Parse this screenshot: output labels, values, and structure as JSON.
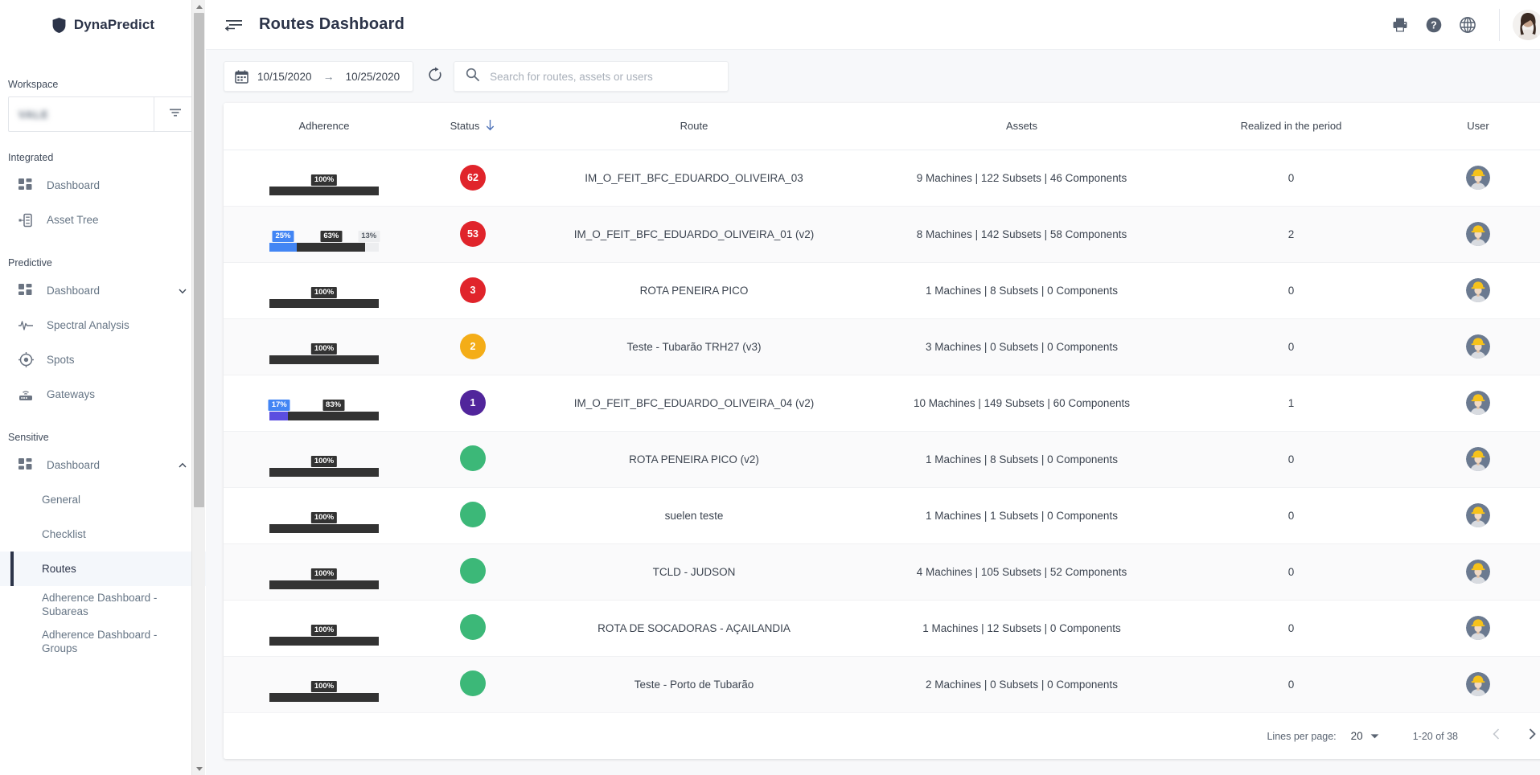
{
  "brand": {
    "name": "DynaPredict",
    "icon": "shield-icon"
  },
  "sidebar": {
    "workspace_label": "Workspace",
    "workspace_value": "VALE",
    "filter_icon": "filter-icon",
    "groups": [
      {
        "label": "Integrated",
        "items": [
          {
            "label": "Dashboard",
            "icon": "dashboard-icon",
            "chevron": null
          },
          {
            "label": "Asset Tree",
            "icon": "asset-tree-icon",
            "chevron": null
          }
        ]
      },
      {
        "label": "Predictive",
        "items": [
          {
            "label": "Dashboard",
            "icon": "dashboard-icon",
            "chevron": "chevron-down-icon"
          },
          {
            "label": "Spectral Analysis",
            "icon": "spectral-analysis-icon",
            "chevron": null
          },
          {
            "label": "Spots",
            "icon": "spots-icon",
            "chevron": null
          },
          {
            "label": "Gateways",
            "icon": "gateways-icon",
            "chevron": null
          }
        ]
      },
      {
        "label": "Sensitive",
        "items": [
          {
            "label": "Dashboard",
            "icon": "dashboard-icon",
            "chevron": "chevron-up-icon"
          }
        ],
        "subitems": [
          {
            "label": "General",
            "active": false
          },
          {
            "label": "Checklist",
            "active": false
          },
          {
            "label": "Routes",
            "active": true
          },
          {
            "label": "Adherence Dashboard - Subareas",
            "active": false
          },
          {
            "label": "Adherence Dashboard - Groups",
            "active": false
          }
        ]
      }
    ]
  },
  "topbar": {
    "menu_icon": "hamburger-collapse-icon",
    "title": "Routes Dashboard",
    "actions": [
      {
        "name": "print-icon"
      },
      {
        "name": "help-icon"
      },
      {
        "name": "language-icon"
      }
    ],
    "avatar": "user-avatar",
    "avatar_chevron": "chevron-down-icon"
  },
  "toolbar": {
    "calendar_icon": "calendar-icon",
    "date_start": "10/15/2020",
    "date_arrow": "→",
    "date_end": "10/25/2020",
    "refresh_icon": "refresh-icon",
    "search_icon": "search-icon",
    "search_placeholder": "Search for routes, assets or users",
    "search_value": ""
  },
  "table": {
    "columns": [
      {
        "key": "adherence",
        "label": "Adherence"
      },
      {
        "key": "status",
        "label": "Status",
        "sort_icon": "sort-descending-arrow-icon"
      },
      {
        "key": "route",
        "label": "Route"
      },
      {
        "key": "assets",
        "label": "Assets"
      },
      {
        "key": "realized",
        "label": "Realized in the period"
      },
      {
        "key": "user",
        "label": "User"
      }
    ],
    "rows": [
      {
        "adherence": [
          {
            "pct": 100,
            "label": "100%",
            "color": "#333333",
            "label_bg": "#333333"
          }
        ],
        "status": {
          "value": "62",
          "color": "#e0242b"
        },
        "route": "IM_O_FEIT_BFC_EDUARDO_OLIVEIRA_03",
        "assets": "9 Machines | 122 Subsets | 46 Components",
        "realized": "0",
        "user": "worker-avatar"
      },
      {
        "adherence": [
          {
            "pct": 25,
            "label": "25%",
            "color": "#4285f4",
            "label_bg": "#4285f4"
          },
          {
            "pct": 63,
            "label": "63%",
            "color": "#333333",
            "label_bg": "#333333"
          },
          {
            "pct": 13,
            "label": "13%",
            "color": "#edeef0",
            "label_bg": "#edeef0",
            "label_color": "#555c66"
          }
        ],
        "status": {
          "value": "53",
          "color": "#e0242b"
        },
        "route": "IM_O_FEIT_BFC_EDUARDO_OLIVEIRA_01 (v2)",
        "assets": "8 Machines | 142 Subsets | 58 Components",
        "realized": "2",
        "user": "worker-avatar"
      },
      {
        "adherence": [
          {
            "pct": 100,
            "label": "100%",
            "color": "#333333",
            "label_bg": "#333333"
          }
        ],
        "status": {
          "value": "3",
          "color": "#e0242b"
        },
        "route": "ROTA PENEIRA PICO",
        "assets": "1 Machines | 8 Subsets | 0 Components",
        "realized": "0",
        "user": "worker-avatar"
      },
      {
        "adherence": [
          {
            "pct": 100,
            "label": "100%",
            "color": "#333333",
            "label_bg": "#333333"
          }
        ],
        "status": {
          "value": "2",
          "color": "#f4ad18"
        },
        "route": "Teste - Tubarão TRH27 (v3)",
        "assets": "3 Machines | 0 Subsets | 0 Components",
        "realized": "0",
        "user": "worker-avatar"
      },
      {
        "adherence": [
          {
            "pct": 17,
            "label": "17%",
            "color": "#5b4ee0",
            "label_bg": "#4285f4"
          },
          {
            "pct": 83,
            "label": "83%",
            "color": "#333333",
            "label_bg": "#333333"
          }
        ],
        "status": {
          "value": "1",
          "color": "#51259b"
        },
        "route": "IM_O_FEIT_BFC_EDUARDO_OLIVEIRA_04 (v2)",
        "assets": "10 Machines | 149 Subsets | 60 Components",
        "realized": "1",
        "user": "worker-avatar"
      },
      {
        "adherence": [
          {
            "pct": 100,
            "label": "100%",
            "color": "#333333",
            "label_bg": "#333333"
          }
        ],
        "status": {
          "value": "",
          "color": "#3cb878"
        },
        "route": "ROTA PENEIRA PICO (v2)",
        "assets": "1 Machines | 8 Subsets | 0 Components",
        "realized": "0",
        "user": "worker-avatar"
      },
      {
        "adherence": [
          {
            "pct": 100,
            "label": "100%",
            "color": "#333333",
            "label_bg": "#333333"
          }
        ],
        "status": {
          "value": "",
          "color": "#3cb878"
        },
        "route": "suelen teste",
        "assets": "1 Machines | 1 Subsets | 0 Components",
        "realized": "0",
        "user": "worker-avatar"
      },
      {
        "adherence": [
          {
            "pct": 100,
            "label": "100%",
            "color": "#333333",
            "label_bg": "#333333"
          }
        ],
        "status": {
          "value": "",
          "color": "#3cb878"
        },
        "route": "TCLD - JUDSON",
        "assets": "4 Machines | 105 Subsets | 52 Components",
        "realized": "0",
        "user": "worker-avatar"
      },
      {
        "adherence": [
          {
            "pct": 100,
            "label": "100%",
            "color": "#333333",
            "label_bg": "#333333"
          }
        ],
        "status": {
          "value": "",
          "color": "#3cb878"
        },
        "route": "ROTA DE SOCADORAS - AÇAILANDIA",
        "assets": "1 Machines | 12 Subsets | 0 Components",
        "realized": "0",
        "user": "worker-avatar"
      },
      {
        "adherence": [
          {
            "pct": 100,
            "label": "100%",
            "color": "#333333",
            "label_bg": "#333333"
          }
        ],
        "status": {
          "value": "",
          "color": "#3cb878"
        },
        "route": "Teste - Porto de Tubarão",
        "assets": "2 Machines | 0 Subsets | 0 Components",
        "realized": "0",
        "user": "worker-avatar"
      }
    ]
  },
  "footer": {
    "lines_per_page_label": "Lines per page:",
    "lines_per_page_value": "20",
    "lines_per_page_chevron": "chevron-down-icon",
    "range_label": "1-20 of 38",
    "prev_icon": "chevron-left-icon",
    "next_icon": "chevron-right-icon"
  },
  "colors": {
    "brand_dark": "#2c3449",
    "accent_blue": "#4285f4",
    "red": "#e0242b",
    "amber": "#f4ad18",
    "green": "#3cb878",
    "purple": "#51259b"
  }
}
